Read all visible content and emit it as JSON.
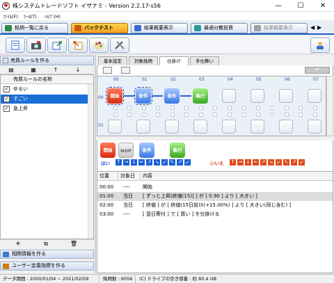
{
  "window": {
    "title": "株システムトレードソフト イザナミ - Version 2.2.17-s56",
    "minimize_glyph": "—",
    "maximize_glyph": "☐",
    "close_glyph": "✕"
  },
  "menu": [
    "ﾌｧｲﾙ(F)",
    "ﾂｰﾙ(T)",
    "ﾍﾙﾌﾟ(H)"
  ],
  "nav_tabs": [
    {
      "label": "銘柄一覧に戻る",
      "state": "normal"
    },
    {
      "label": "バックテスト",
      "state": "active"
    },
    {
      "label": "結果概要表示",
      "state": "normal"
    },
    {
      "label": "最適分散投資",
      "state": "normal"
    },
    {
      "label": "結果概要表示",
      "state": "disabled"
    }
  ],
  "toolbar_icons": [
    "new-file-icon",
    "camera-icon",
    "export-icon",
    "import-icon",
    "paint-palette-icon",
    "tools-icon",
    "user-help-icon"
  ],
  "left": {
    "section_title": "売買ルールを作る",
    "list_header": "売買ルールの名称",
    "rules": [
      {
        "name": "ゆるい",
        "checked": true,
        "selected": false
      },
      {
        "name": "すごい",
        "checked": true,
        "selected": true
      },
      {
        "name": "急上昇",
        "checked": true,
        "selected": false
      }
    ],
    "bottom_buttons": [
      {
        "label": "相関情報を作る"
      },
      {
        "label": "ユーザー定義指標を作る"
      }
    ],
    "add_glyph": "+",
    "delete_glyph": "🗑",
    "up_glyph": "↑",
    "down_glyph": "↓"
  },
  "subtabs": [
    "基本設定",
    "対象銘柄",
    "仕掛け",
    "手仕舞い"
  ],
  "active_subtab": "仕掛け",
  "flow": {
    "col_headers": [
      "00",
      "01",
      "02",
      "03",
      "04",
      "05",
      "06",
      "07"
    ],
    "row_headers": [
      "00",
      "01"
    ],
    "nodes": [
      {
        "label": "開始",
        "kind": "start"
      },
      {
        "label": "条件",
        "kind": "cond"
      },
      {
        "label": "条件",
        "kind": "cond"
      },
      {
        "label": "執行",
        "kind": "exec"
      }
    ]
  },
  "palette": {
    "items": [
      {
        "label": "開始",
        "kind": "start"
      },
      {
        "label": "NOP",
        "kind": "nop"
      },
      {
        "label": "条件",
        "kind": "cond"
      },
      {
        "label": "執行",
        "kind": "exec"
      }
    ],
    "yes_label": "はい",
    "no_label": "いいえ",
    "yes_arrows": [
      "↑",
      "→",
      "↓",
      "←",
      "↗",
      "↘",
      "↙",
      "↖",
      "↗",
      "↙"
    ],
    "no_arrows": [
      "↑",
      "→",
      "↓",
      "←",
      "↗",
      "↘",
      "↙",
      "↖",
      "↗",
      "↙"
    ]
  },
  "table": {
    "headers": [
      "位置",
      "対象日",
      "内容"
    ],
    "rows": [
      {
        "pos": "00:00",
        "day": "----",
        "content": "開始"
      },
      {
        "pos": "01:00",
        "day": "当日",
        "content": "[ ずっと上昇[終値(15)] ] が [ 0.90 ] より [ 大きい ]"
      },
      {
        "pos": "02:00",
        "day": "当日",
        "content": "[ 終値 ] が [ 終値(15日前)X(+15.00%) ] より [ 大きい(同じ含む) ]"
      },
      {
        "pos": "03:00",
        "day": "----",
        "content": "[ 翌日寄付 ] で [ 買い ] を仕掛ける"
      }
    ]
  },
  "status": {
    "data_period": "データ期間 : 2000/01/04 ~ 2021/02/09",
    "stock_count": "銘柄数 : 6056",
    "copyright": "(C) ドライブの空き容量 : 約 80.4 GB"
  },
  "colors": {
    "accent": "#1e60c8",
    "active_tab": "#f0a020",
    "selection": "#1a6fd6",
    "start": "#d82c10",
    "condition": "#3a78e6",
    "execute": "#3aa820"
  }
}
